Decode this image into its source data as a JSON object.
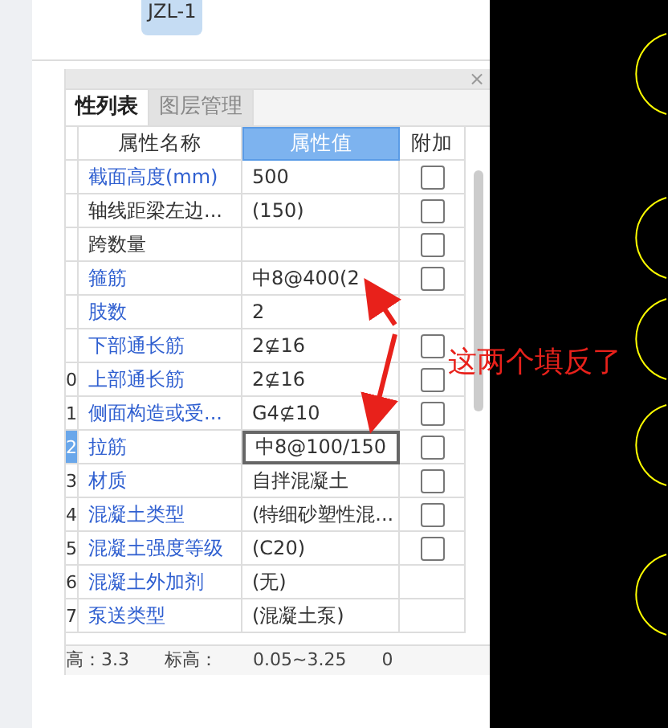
{
  "badge": "JZL-1",
  "panel": {
    "close": "×",
    "tabs": [
      {
        "label": "性列表",
        "selected": true
      },
      {
        "label": "图层管理",
        "selected": false
      }
    ],
    "columns": [
      "属性名称",
      "属性值",
      "附加"
    ],
    "rows": [
      {
        "number": "",
        "name": "截面高度(mm)",
        "color": "#2f5fd0",
        "value": "500",
        "kind": "checkbox",
        "checked": false,
        "selected": false
      },
      {
        "number": "",
        "name": "轴线距梁左边...",
        "color": "#333333",
        "value": "(150)",
        "kind": "checkbox",
        "checked": false,
        "selected": false
      },
      {
        "number": "",
        "name": "跨数量",
        "color": "#333333",
        "value": "",
        "kind": "checkbox",
        "checked": false,
        "selected": false
      },
      {
        "number": "",
        "name": "箍筋",
        "color": "#2f5fd0",
        "value": "中8@400(2",
        "kind": "checkbox",
        "checked": false,
        "selected": false
      },
      {
        "number": "",
        "name": "肢数",
        "color": "#2f5fd0",
        "value": "2",
        "kind": "plain",
        "selected": false
      },
      {
        "number": "",
        "name": "下部通长筋",
        "color": "#2f5fd0",
        "value": "2⊈16",
        "kind": "checkbox",
        "checked": false,
        "selected": false
      },
      {
        "number": "0",
        "name": "上部通长筋",
        "color": "#2f5fd0",
        "value": "2⊈16",
        "kind": "checkbox",
        "checked": false,
        "selected": false
      },
      {
        "number": "1",
        "name": "侧面构造或受...",
        "color": "#2f5fd0",
        "value": "G4⊈10",
        "kind": "checkbox",
        "checked": false,
        "selected": false
      },
      {
        "number": "2",
        "name": "拉筋",
        "color": "#2f5fd0",
        "value": "中8@100/150",
        "kind": "checkbox",
        "checked": false,
        "selected": true
      },
      {
        "number": "3",
        "name": "材质",
        "color": "#2f5fd0",
        "value": "自拌混凝土",
        "kind": "checkbox",
        "checked": false,
        "selected": false
      },
      {
        "number": "4",
        "name": "混凝土类型",
        "color": "#2f5fd0",
        "value": "(特细砂塑性混...",
        "kind": "checkbox",
        "checked": false,
        "selected": false
      },
      {
        "number": "5",
        "name": "混凝土强度等级",
        "color": "#2f5fd0",
        "value": "(C20)",
        "kind": "checkbox",
        "checked": false,
        "selected": false
      },
      {
        "number": "6",
        "name": "混凝土外加剂",
        "color": "#2f5fd0",
        "value": "(无)",
        "kind": "plain",
        "selected": false
      },
      {
        "number": "7",
        "name": "泵送类型",
        "color": "#2f5fd0",
        "value": "(混凝土泵)",
        "kind": "plain",
        "selected": false
      }
    ],
    "status": [
      "高：3.3",
      "标高：",
      "0.05~3.25",
      "0"
    ]
  },
  "annotation": {
    "text": "这两个填反了"
  }
}
